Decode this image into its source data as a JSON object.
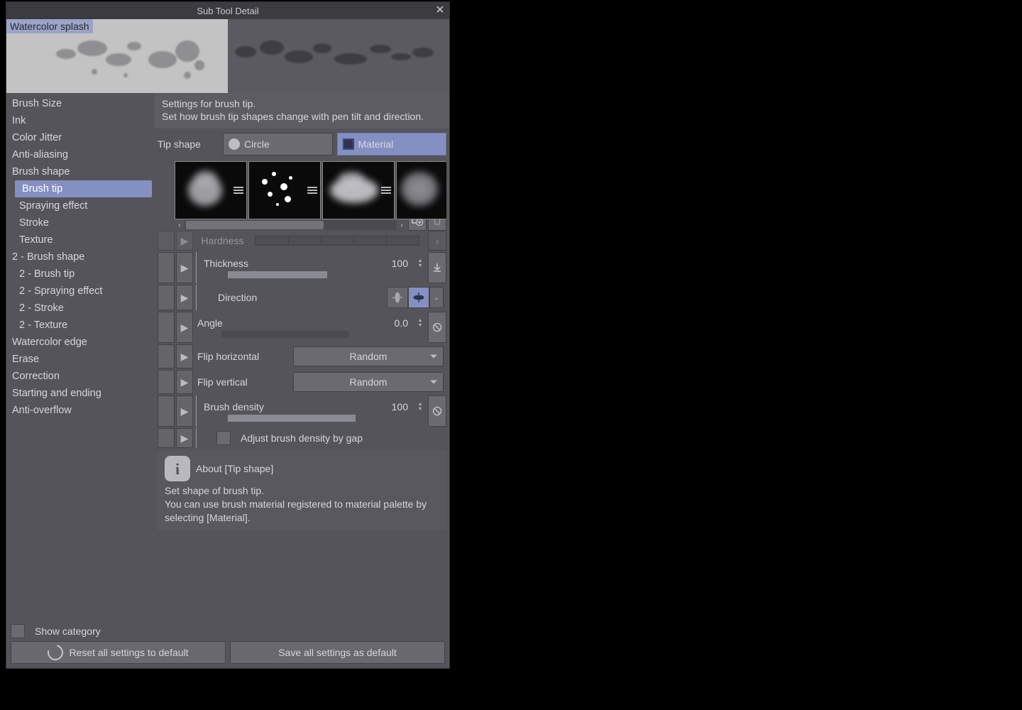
{
  "window": {
    "title": "Sub Tool Detail"
  },
  "preview": {
    "name": "Watercolor splash"
  },
  "sidebar": {
    "items": [
      {
        "label": "Brush Size",
        "indent": false
      },
      {
        "label": "Ink",
        "indent": false
      },
      {
        "label": "Color Jitter",
        "indent": false
      },
      {
        "label": "Anti-aliasing",
        "indent": false
      },
      {
        "label": "Brush shape",
        "indent": false
      },
      {
        "label": "Brush tip",
        "indent": true,
        "selected": true
      },
      {
        "label": "Spraying effect",
        "indent": true
      },
      {
        "label": "Stroke",
        "indent": true
      },
      {
        "label": "Texture",
        "indent": true
      },
      {
        "label": "2 - Brush shape",
        "indent": false
      },
      {
        "label": "2 - Brush tip",
        "indent": true
      },
      {
        "label": "2 - Spraying effect",
        "indent": true
      },
      {
        "label": "2 - Stroke",
        "indent": true
      },
      {
        "label": "2 - Texture",
        "indent": true
      },
      {
        "label": "Watercolor edge",
        "indent": false
      },
      {
        "label": "Erase",
        "indent": false
      },
      {
        "label": "Correction",
        "indent": false
      },
      {
        "label": "Starting and ending",
        "indent": false
      },
      {
        "label": "Anti-overflow",
        "indent": false
      }
    ]
  },
  "main": {
    "description": "Settings for brush tip.\nSet how brush tip shapes change with pen tilt and direction.",
    "tip_shape_label": "Tip shape",
    "tip_shape_circle": "Circle",
    "tip_shape_material": "Material",
    "params": {
      "hardness": {
        "label": "Hardness"
      },
      "thickness": {
        "label": "Thickness",
        "value": "100"
      },
      "direction": {
        "label": "Direction"
      },
      "angle": {
        "label": "Angle",
        "value": "0.0"
      },
      "flip_h": {
        "label": "Flip horizontal",
        "value": "Random"
      },
      "flip_v": {
        "label": "Flip vertical",
        "value": "Random"
      },
      "density": {
        "label": "Brush density",
        "value": "100"
      },
      "adjust_gap": {
        "label": "Adjust brush density by gap"
      }
    },
    "about": {
      "head": "About [Tip shape]",
      "body": "Set shape of brush tip.\nYou can use brush material registered to material palette by selecting [Material]."
    }
  },
  "footer": {
    "show_category": "Show category",
    "reset": "Reset all settings to default",
    "save": "Save all settings as default"
  }
}
